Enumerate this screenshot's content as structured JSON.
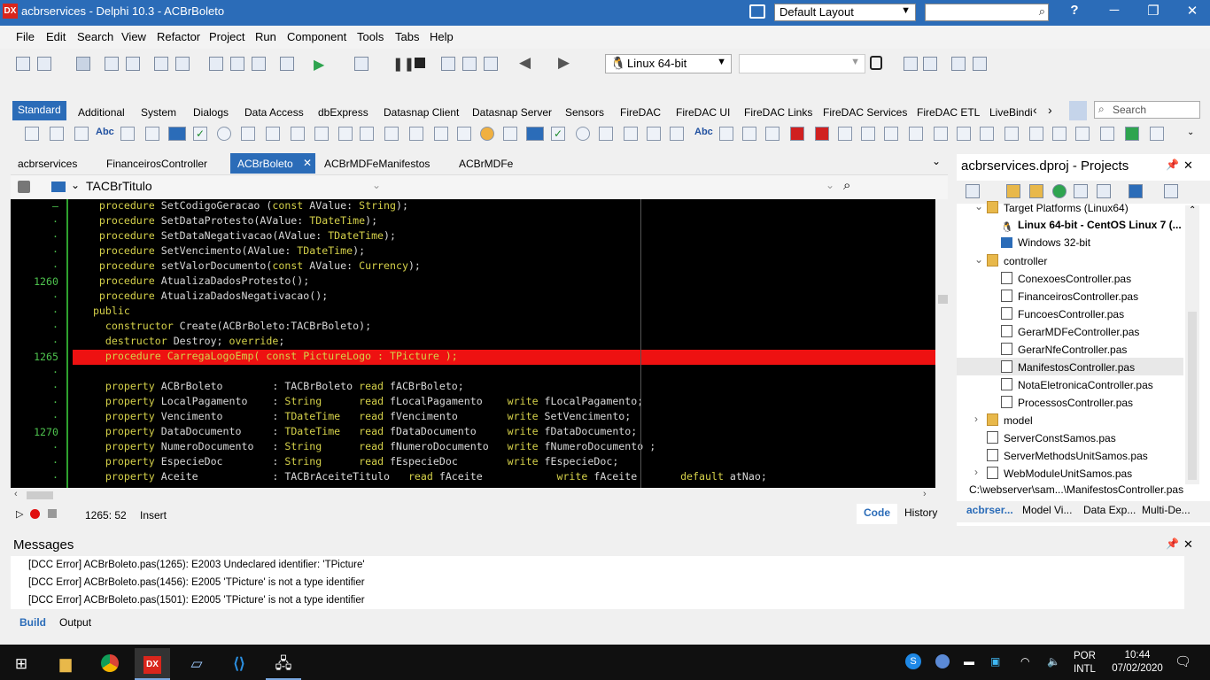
{
  "window": {
    "title": "acbrservices - Delphi 10.3 - ACBrBoleto",
    "logo": "DX",
    "layout": "Default Layout"
  },
  "menu": [
    "File",
    "Edit",
    "Search",
    "View",
    "Refactor",
    "Project",
    "Run",
    "Component",
    "Tools",
    "Tabs",
    "Help"
  ],
  "toolbar": {
    "platform": "Linux 64-bit"
  },
  "palette": {
    "tabs": [
      "Standard",
      "Additional",
      "System",
      "Dialogs",
      "Data Access",
      "dbExpress",
      "Datasnap Client",
      "Datasnap Server",
      "Sensors",
      "FireDAC",
      "FireDAC UI",
      "FireDAC Links",
      "FireDAC Services",
      "FireDAC ETL",
      "LiveBindi"
    ],
    "search_placeholder": "Search"
  },
  "editor": {
    "tabs": [
      "acbrservices",
      "FinanceirosController",
      "ACBrBoleto",
      "ACBrMDFeManifestos",
      "ACBrMDFe"
    ],
    "active_tab": "ACBrBoleto",
    "class_combo": "TACBrTitulo",
    "lines": [
      {
        "num": "–",
        "text": "    procedure SetCodigoGeracao (const AValue: String);"
      },
      {
        "num": "·",
        "text": "    procedure SetDataProtesto(AValue: TDateTime);"
      },
      {
        "num": "·",
        "text": "    procedure SetDataNegativacao(AValue: TDateTime);"
      },
      {
        "num": "·",
        "text": "    procedure SetVencimento(AValue: TDateTime);"
      },
      {
        "num": "·",
        "text": "    procedure setValorDocumento(const AValue: Currency);"
      },
      {
        "num": "1260",
        "text": "    procedure AtualizaDadosProtesto();"
      },
      {
        "num": "·",
        "text": "    procedure AtualizaDadosNegativacao();"
      },
      {
        "num": "·",
        "text": "   public"
      },
      {
        "num": "·",
        "text": "     constructor Create(ACBrBoleto:TACBrBoleto);"
      },
      {
        "num": "·",
        "text": "     destructor Destroy; override;"
      },
      {
        "num": "1265",
        "text": "     procedure CarregaLogoEmp( const PictureLogo : TPicture );"
      },
      {
        "num": "·",
        "text": ""
      },
      {
        "num": "·",
        "text": "     property ACBrBoleto        : TACBrBoleto read fACBrBoleto;"
      },
      {
        "num": "·",
        "text": "     property LocalPagamento    : String      read fLocalPagamento    write fLocalPagamento;"
      },
      {
        "num": "·",
        "text": "     property Vencimento        : TDateTime   read fVencimento        write SetVencimento;"
      },
      {
        "num": "1270",
        "text": "     property DataDocumento     : TDateTime   read fDataDocumento     write fDataDocumento;"
      },
      {
        "num": "·",
        "text": "     property NumeroDocumento   : String      read fNumeroDocumento   write fNumeroDocumento ;"
      },
      {
        "num": "·",
        "text": "     property EspecieDoc        : String      read fEspecieDoc        write fEspecieDoc;"
      },
      {
        "num": "·",
        "text": "     property Aceite            : TACBrAceiteTitulo   read fAceite            write fAceite       default atNao;"
      }
    ],
    "error_line_index": 10
  },
  "status": {
    "position": "1265:  52",
    "mode": "Insert",
    "code_tab": "Code",
    "history_tab": "History"
  },
  "projects": {
    "title": "acbrservices.dproj - Projects",
    "items": [
      {
        "label": "Target Platforms (Linux64)",
        "indent": 1,
        "kind": "fold",
        "exp": "v"
      },
      {
        "label": "Linux 64-bit - CentOS Linux 7 (...",
        "indent": 2,
        "kind": "linux",
        "bold": true
      },
      {
        "label": "Windows 32-bit",
        "indent": 2,
        "kind": "win"
      },
      {
        "label": "controller",
        "indent": 1,
        "kind": "fold",
        "exp": "v"
      },
      {
        "label": "ConexoesController.pas",
        "indent": 2,
        "kind": "file"
      },
      {
        "label": "FinanceirosController.pas",
        "indent": 2,
        "kind": "file"
      },
      {
        "label": "FuncoesController.pas",
        "indent": 2,
        "kind": "file"
      },
      {
        "label": "GerarMDFeController.pas",
        "indent": 2,
        "kind": "file"
      },
      {
        "label": "GerarNfeController.pas",
        "indent": 2,
        "kind": "file"
      },
      {
        "label": "ManifestosController.pas",
        "indent": 2,
        "kind": "file",
        "selected": true
      },
      {
        "label": "NotaEletronicaController.pas",
        "indent": 2,
        "kind": "file"
      },
      {
        "label": "ProcessosController.pas",
        "indent": 2,
        "kind": "file"
      },
      {
        "label": "model",
        "indent": 1,
        "kind": "fold",
        "exp": ">"
      },
      {
        "label": "ServerConstSamos.pas",
        "indent": 1,
        "kind": "file"
      },
      {
        "label": "ServerMethodsUnitSamos.pas",
        "indent": 1,
        "kind": "file"
      },
      {
        "label": "WebModuleUnitSamos.pas",
        "indent": 1,
        "kind": "file",
        "exp": ">"
      }
    ],
    "path": "C:\\webserver\\sam...\\ManifestosController.pas",
    "tabs": [
      "acbrser...",
      "Model Vi...",
      "Data Exp...",
      "Multi-De..."
    ]
  },
  "messages": {
    "title": "Messages",
    "rows": [
      "[DCC Error] ACBrBoleto.pas(1265): E2003 Undeclared identifier: 'TPicture'",
      "[DCC Error] ACBrBoleto.pas(1456): E2005 'TPicture' is not a type identifier",
      "[DCC Error] ACBrBoleto.pas(1501): E2005 'TPicture' is not a type identifier"
    ],
    "tabs": [
      "Build",
      "Output"
    ]
  },
  "taskbar": {
    "lang1": "POR",
    "lang2": "INTL",
    "time": "10:44",
    "date": "07/02/2020"
  }
}
